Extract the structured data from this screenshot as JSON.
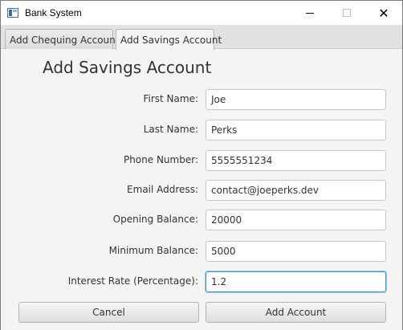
{
  "window": {
    "title": "Bank System",
    "controls": {
      "minimize_icon": "minimize-icon",
      "maximize_icon": "maximize-icon",
      "close_glyph": "✕"
    }
  },
  "tabs": [
    {
      "label": "Add Chequing Account",
      "active": false
    },
    {
      "label": "Add Savings Account",
      "active": true
    }
  ],
  "form": {
    "heading": "Add Savings Account",
    "fields": [
      {
        "label": "First Name:",
        "value": "Joe"
      },
      {
        "label": "Last Name:",
        "value": "Perks"
      },
      {
        "label": "Phone Number:",
        "value": "5555551234"
      },
      {
        "label": "Email Address:",
        "value": "contact@joeperks.dev"
      },
      {
        "label": "Opening Balance:",
        "value": "20000"
      },
      {
        "label": "Minimum Balance:",
        "value": "5000"
      },
      {
        "label": "Interest Rate (Percentage):",
        "value": "1.2",
        "focused": true
      }
    ],
    "cancel_label": "Cancel",
    "submit_label": "Add Account"
  },
  "colors": {
    "focus_border": "#3d96d4",
    "background": "#f4f4f4"
  }
}
